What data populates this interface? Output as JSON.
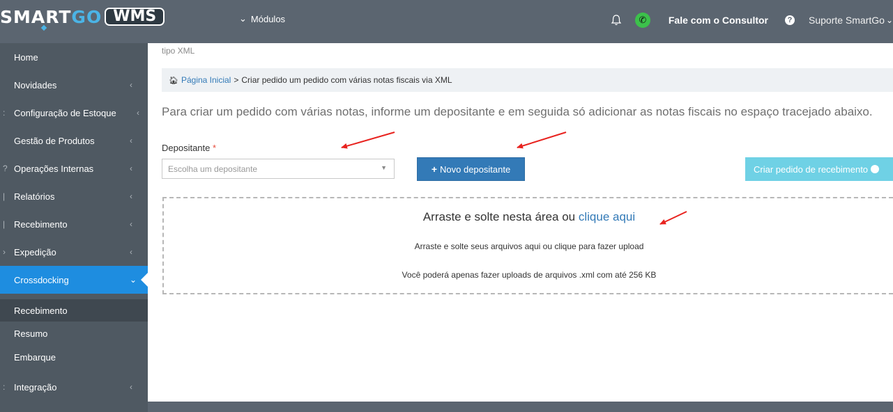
{
  "header": {
    "logo_smart": "SMART",
    "logo_go": "GO",
    "logo_wms": "WMS",
    "modules_label": "Módulos",
    "consultor_label": "Fale com o Consultor",
    "support_label": "Suporte SmartGo"
  },
  "icons": {
    "bell": "bell-icon",
    "whatsapp": "whatsapp-icon",
    "help": "question-circle-icon",
    "home": "home-icon",
    "plus": "plus-icon"
  },
  "sidebar": {
    "items": [
      {
        "label": "Home"
      },
      {
        "label": "Novidades"
      },
      {
        "label": "Configuração de Estoque"
      },
      {
        "label": "Gestão de Produtos"
      },
      {
        "label": "Operações Internas"
      },
      {
        "label": "Relatórios"
      },
      {
        "label": "Recebimento"
      },
      {
        "label": "Expedição"
      },
      {
        "label": "Crossdocking"
      },
      {
        "label": "Integração"
      }
    ],
    "subitems": [
      {
        "label": "Recebimento"
      },
      {
        "label": "Resumo"
      },
      {
        "label": "Embarque"
      }
    ]
  },
  "main": {
    "page_title_fragment": "tipo XML",
    "breadcrumb": {
      "home": "Página Inicial",
      "separator": ">",
      "current": "Criar pedido um pedido com várias notas fiscais via XML"
    },
    "intro": "Para criar um pedido com várias notas, informe um depositante e em seguida só adicionar as notas fiscais no espaço tracejado abaixo.",
    "depositante_label": "Depositante",
    "required_mark": "*",
    "depositante_placeholder": "Escolha um depositante",
    "novo_depositante_label": "Novo depositante",
    "criar_pedido_label": "Criar pedido de recebimento",
    "dropzone": {
      "title_prefix": "Arraste e solte nesta área ou",
      "title_link": "clique aqui",
      "subtitle": "Arraste e solte seus arquivos aqui ou clique para fazer upload",
      "limit": "Você poderá apenas fazer uploads de arquivos .xml com até 256 KB"
    }
  },
  "colors": {
    "topbar": "#5b6570",
    "sidebar": "#4f5962",
    "active": "#1e8de0",
    "primary_button": "#337ab7",
    "info_button": "#6fd1e5",
    "annotation_arrow": "#e8231f"
  }
}
